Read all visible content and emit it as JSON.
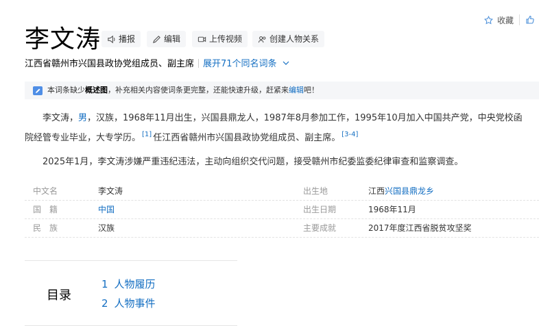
{
  "title": "李文涛",
  "actions": {
    "broadcast": "播报",
    "edit": "编辑",
    "upload_video": "上传视频",
    "create_relation": "创建人物关系"
  },
  "toolbar": {
    "favorite": "收藏"
  },
  "subtitle": {
    "text": "江西省赣州市兴国县政协党组成员、副主席",
    "expand": "展开71个同名词条"
  },
  "notice": {
    "prefix": "本词条缺少",
    "bold": "概述图",
    "middle": "，补充相关内容使词条更完整，还能快速升级，赶紧来",
    "link": "编辑",
    "suffix": "吧！"
  },
  "intro": {
    "p1_a": "李文涛，",
    "p1_link": "男",
    "p1_b": "，汉族，1968年11月出生，兴国县鼎龙人，1987年8月参加工作，1995年10月加入中国共产党，中央党校函",
    "p1_c": "院经管专业毕业，大专学历。",
    "ref1": "[1]",
    "p1_d": "任江西省赣州市兴国县政协党组成员、副主席。",
    "ref2": "[3-4]",
    "p2": "2025年1月，李文涛涉嫌严重违纪违法，主动向组织交代问题，接受赣州市纪委监委纪律审查和监察调查。"
  },
  "basic_info": {
    "rows": [
      {
        "l1": "中文名",
        "v1": "李文涛",
        "l2": "出生地",
        "v2a": "江西",
        "v2b": "兴国县鼎龙乡"
      },
      {
        "l1": "国　籍",
        "v1": "中国",
        "l2": "出生日期",
        "v2": "1968年11月"
      },
      {
        "l1": "民　族",
        "v1": "汉族",
        "l2": "主要成就",
        "v2": "2017年度江西省脱贫攻坚奖"
      }
    ]
  },
  "toc": {
    "heading": "目录",
    "items": [
      {
        "num": "1",
        "label": "人物履历"
      },
      {
        "num": "2",
        "label": "人物事件"
      }
    ]
  },
  "colors": {
    "link": "#136ec2",
    "notice_bg": "#f5f6f8"
  }
}
